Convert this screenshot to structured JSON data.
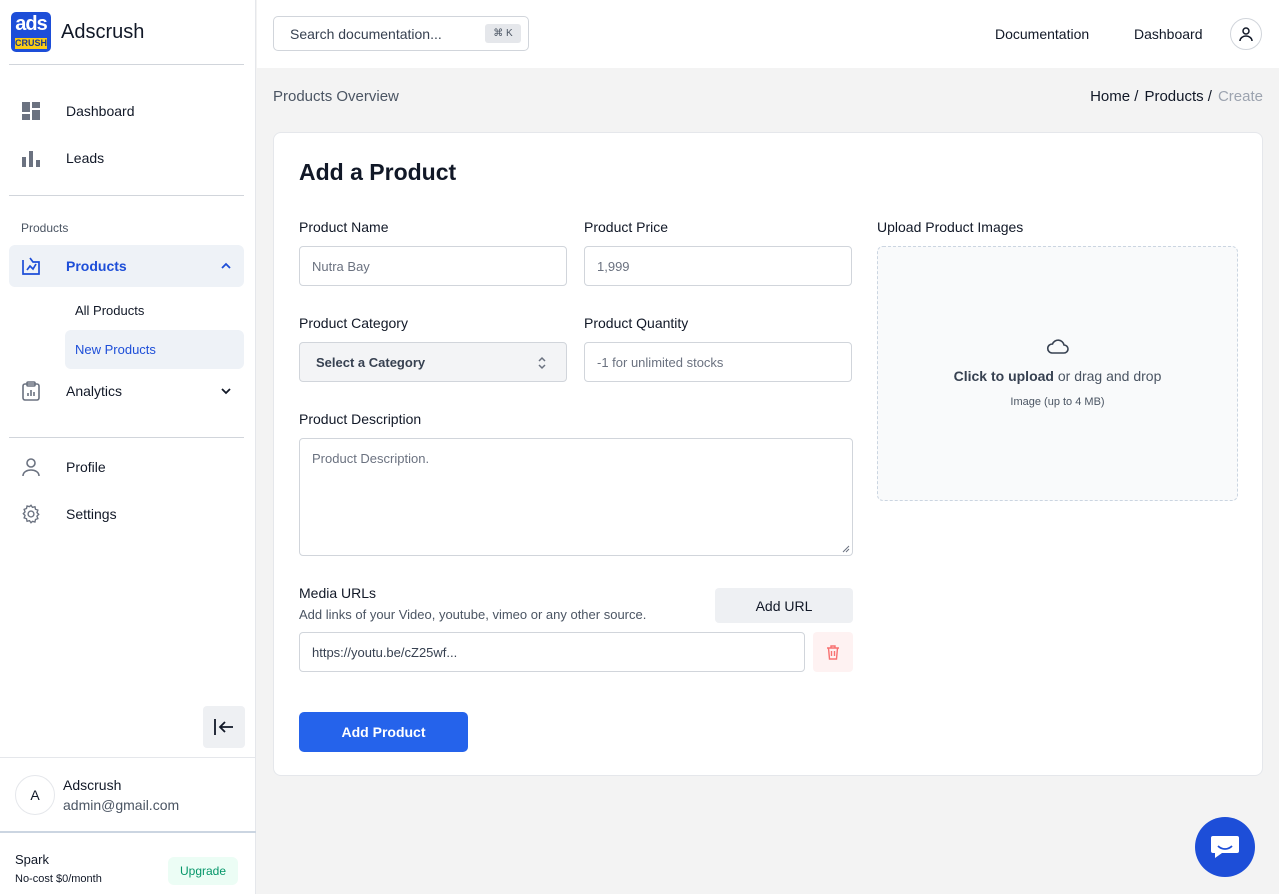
{
  "brand": {
    "logo_top": "ads",
    "logo_bottom": "CRUSH",
    "name": "Adscrush"
  },
  "sidebar": {
    "items": [
      {
        "label": "Dashboard",
        "icon": "dashboard-grid-icon"
      },
      {
        "label": "Leads",
        "icon": "bar-chart-icon"
      }
    ],
    "section_label": "Products",
    "products": {
      "label": "Products",
      "icon": "products-box-icon",
      "expanded": true
    },
    "sub_items": [
      {
        "label": "All Products"
      },
      {
        "label": "New Products",
        "active": true
      }
    ],
    "analytics": {
      "label": "Analytics",
      "icon": "clipboard-chart-icon"
    },
    "bottom_items": [
      {
        "label": "Profile",
        "icon": "user-icon"
      },
      {
        "label": "Settings",
        "icon": "gear-icon"
      }
    ],
    "user": {
      "initial": "A",
      "name": "Adscrush",
      "email": "admin@gmail.com"
    },
    "plan": {
      "name": "Spark",
      "price": "No-cost $0/month",
      "upgrade_label": "Upgrade"
    }
  },
  "topbar": {
    "search_placeholder": "Search documentation...",
    "shortcut": "⌘ K",
    "links": [
      "Documentation",
      "Dashboard"
    ]
  },
  "page": {
    "title": "Products Overview",
    "breadcrumb": [
      "Home /",
      "Products /",
      "Create"
    ]
  },
  "form": {
    "title": "Add a Product",
    "product_name": {
      "label": "Product Name",
      "placeholder": "Nutra Bay"
    },
    "product_price": {
      "label": "Product Price",
      "placeholder": "1,999"
    },
    "product_category": {
      "label": "Product Category",
      "value": "Select a Category"
    },
    "product_quantity": {
      "label": "Product Quantity",
      "placeholder": "-1 for unlimited stocks"
    },
    "product_description": {
      "label": "Product Description",
      "placeholder": "Product Description."
    },
    "media": {
      "label": "Media URLs",
      "help": "Add links of your Video, youtube, vimeo or any other source.",
      "add_label": "Add URL",
      "url_value": "https://youtu.be/cZ25wf..."
    },
    "upload": {
      "label": "Upload Product Images",
      "click_text": "Click to upload",
      "rest_text": " or drag and drop",
      "hint": "Image (up to 4 MB)"
    },
    "submit_label": "Add Product"
  },
  "colors": {
    "primary": "#2563eb",
    "brand": "#1d4ed8",
    "upgrade": "#059669"
  }
}
